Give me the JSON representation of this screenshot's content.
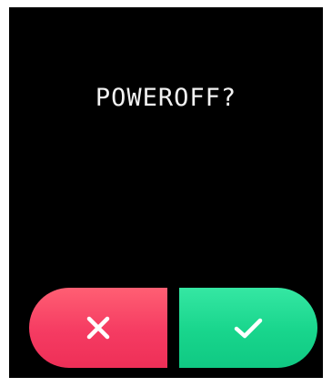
{
  "dialog": {
    "prompt": "POWEROFF?",
    "cancel_icon": "close-icon",
    "confirm_icon": "check-icon"
  },
  "colors": {
    "background": "#000000",
    "cancel_button": "#f53b62",
    "confirm_button": "#18d58c",
    "text": "#f2f2f2",
    "icon": "#ffffff"
  }
}
